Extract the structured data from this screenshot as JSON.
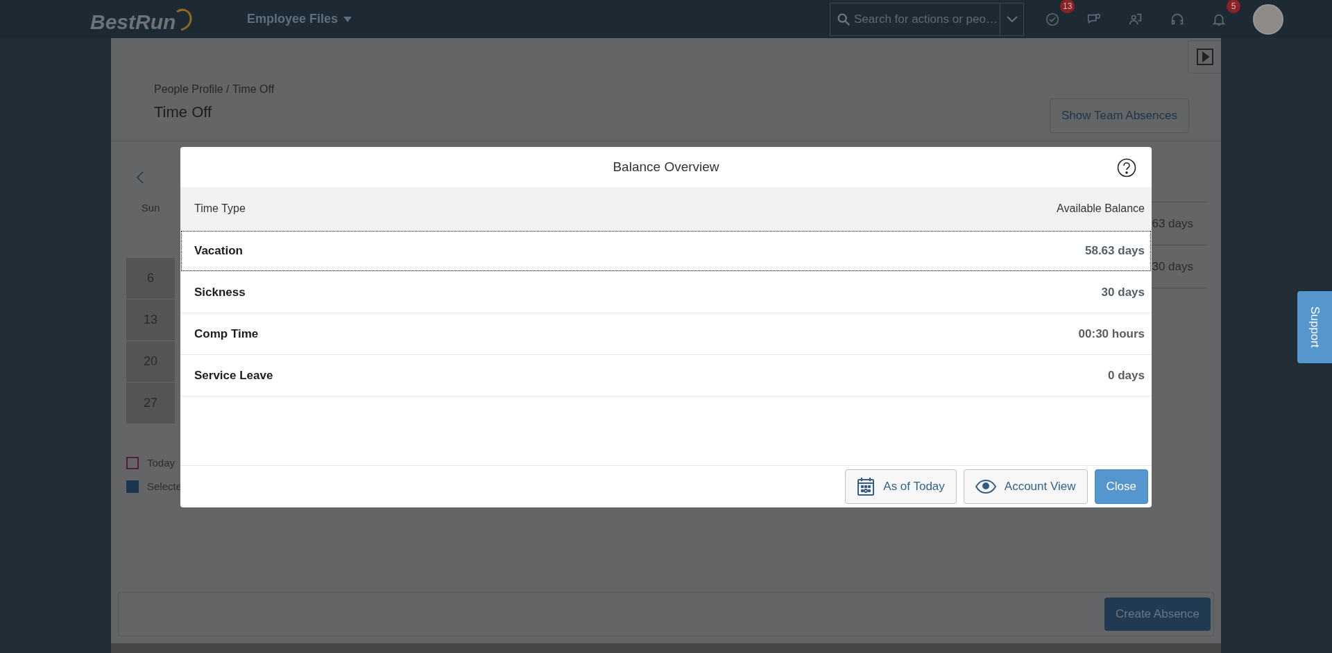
{
  "top_bar": {
    "logo": "BestRun",
    "module_menu": "Employee Files",
    "search": {
      "placeholder": "Search for actions or peo…"
    },
    "badges": [
      {
        "kind": "todo",
        "count": "13"
      },
      {
        "kind": "feedback"
      },
      {
        "kind": "org"
      },
      {
        "kind": "help"
      },
      {
        "kind": "notifications",
        "count": "5"
      }
    ]
  },
  "page": {
    "breadcrumb": "People Profile / Time Off",
    "title": "Time Off",
    "team_button": "Show Team Absences",
    "calendar": {
      "weekday": "Sun",
      "days": [
        "6",
        "13",
        "20",
        "27"
      ]
    },
    "balances_behind": [
      "63 days",
      "30 days"
    ],
    "legend": [
      {
        "kind": "today",
        "label": "Today"
      },
      {
        "kind": "selected",
        "label": "Selecte"
      }
    ],
    "create_button": "Create Absence"
  },
  "dialog": {
    "title": "Balance Overview",
    "columns": [
      "Time Type",
      "Available Balance"
    ],
    "rows": [
      {
        "type": "Vacation",
        "balance": "58.63 days",
        "focused": true
      },
      {
        "type": "Sickness",
        "balance": "30 days",
        "focused": false
      },
      {
        "type": "Comp Time",
        "balance": "00:30 hours",
        "focused": false
      },
      {
        "type": "Service Leave",
        "balance": "0 days",
        "focused": false
      }
    ],
    "buttons": [
      {
        "kind": "calendar",
        "label": "As of Today"
      },
      {
        "kind": "eye",
        "label": "Account View"
      },
      {
        "kind": "primary",
        "label": "Close"
      }
    ]
  },
  "support_tab": "Support"
}
